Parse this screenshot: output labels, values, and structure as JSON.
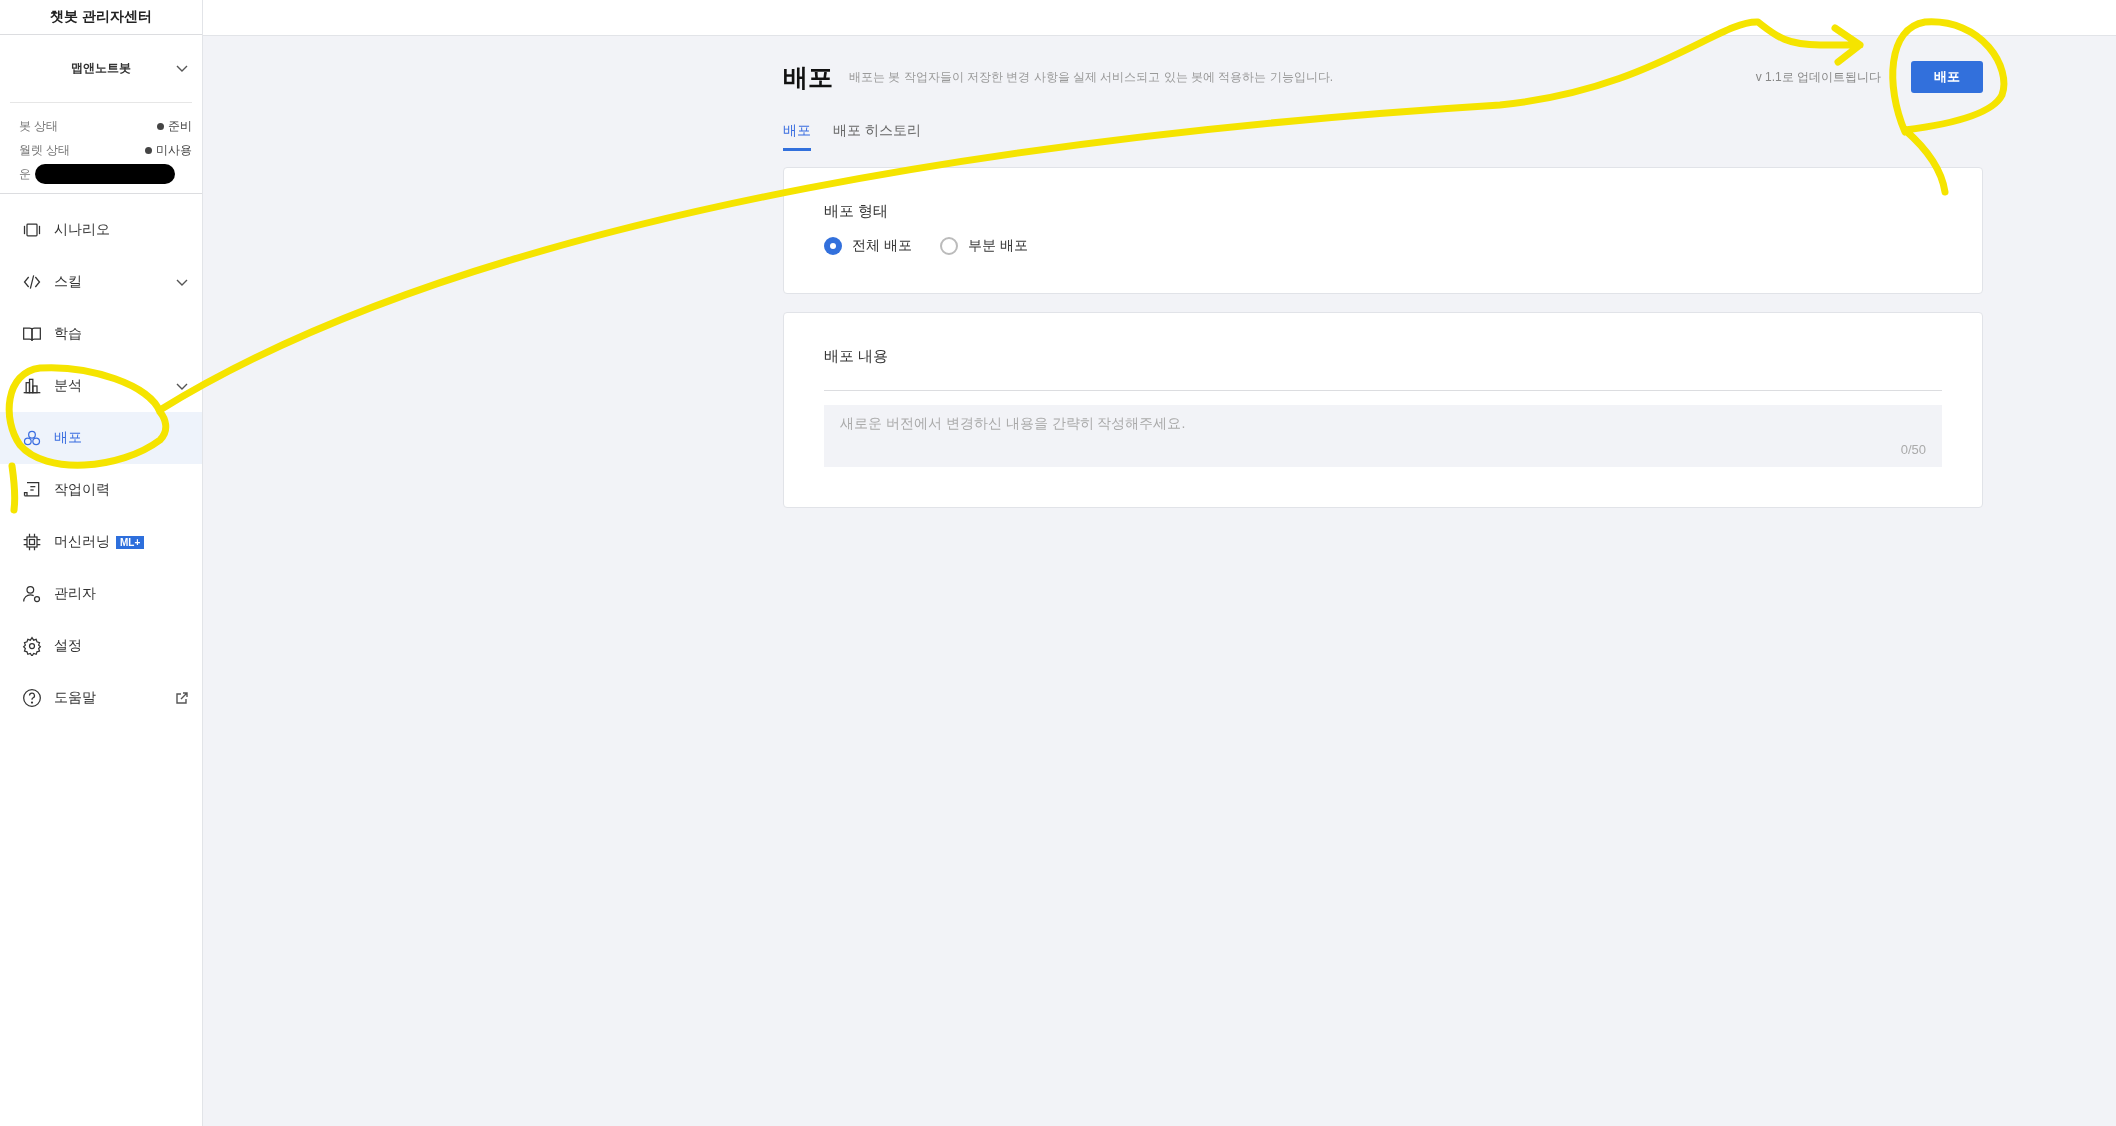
{
  "sidebar": {
    "title": "챗봇 관리자센터",
    "bot_name": "맵앤노트봇",
    "status": [
      {
        "label": "봇 상태",
        "value": "준비"
      },
      {
        "label": "월렛 상태",
        "value": "미사용"
      },
      {
        "label": "운",
        "redacted": true
      }
    ],
    "items": [
      {
        "label": "시나리오",
        "kind": "link",
        "selected": false
      },
      {
        "label": "스킬",
        "kind": "group",
        "selected": false
      },
      {
        "label": "학습",
        "kind": "link",
        "selected": false
      },
      {
        "label": "분석",
        "kind": "group",
        "selected": false
      },
      {
        "label": "배포",
        "kind": "link",
        "selected": true
      },
      {
        "label": "작업이력",
        "kind": "link",
        "selected": false
      },
      {
        "label": "머신러닝",
        "kind": "link",
        "selected": false,
        "badge": "ML+"
      },
      {
        "label": "관리자",
        "kind": "link",
        "selected": false
      },
      {
        "label": "설정",
        "kind": "link",
        "selected": false
      },
      {
        "label": "도움말",
        "kind": "external",
        "selected": false
      }
    ]
  },
  "page": {
    "title": "배포",
    "description": "배포는 봇 작업자들이 저장한 변경 사항을 실제 서비스되고 있는 봇에 적용하는 기능입니다.",
    "version_note": "v 1.1로 업데이트됩니다",
    "deploy_button": "배포",
    "tabs": [
      {
        "label": "배포",
        "selected": true
      },
      {
        "label": "배포 히스토리",
        "selected": false
      }
    ],
    "deploy_type": {
      "title": "배포 형태",
      "options": [
        {
          "label": "전체 배포",
          "selected": true
        },
        {
          "label": "부분 배포",
          "selected": false
        }
      ]
    },
    "deploy_notes": {
      "title": "배포 내용",
      "placeholder": "새로운 버전에서 변경하신 내용을 간략히 작성해주세요.",
      "counter": "0/50"
    }
  }
}
